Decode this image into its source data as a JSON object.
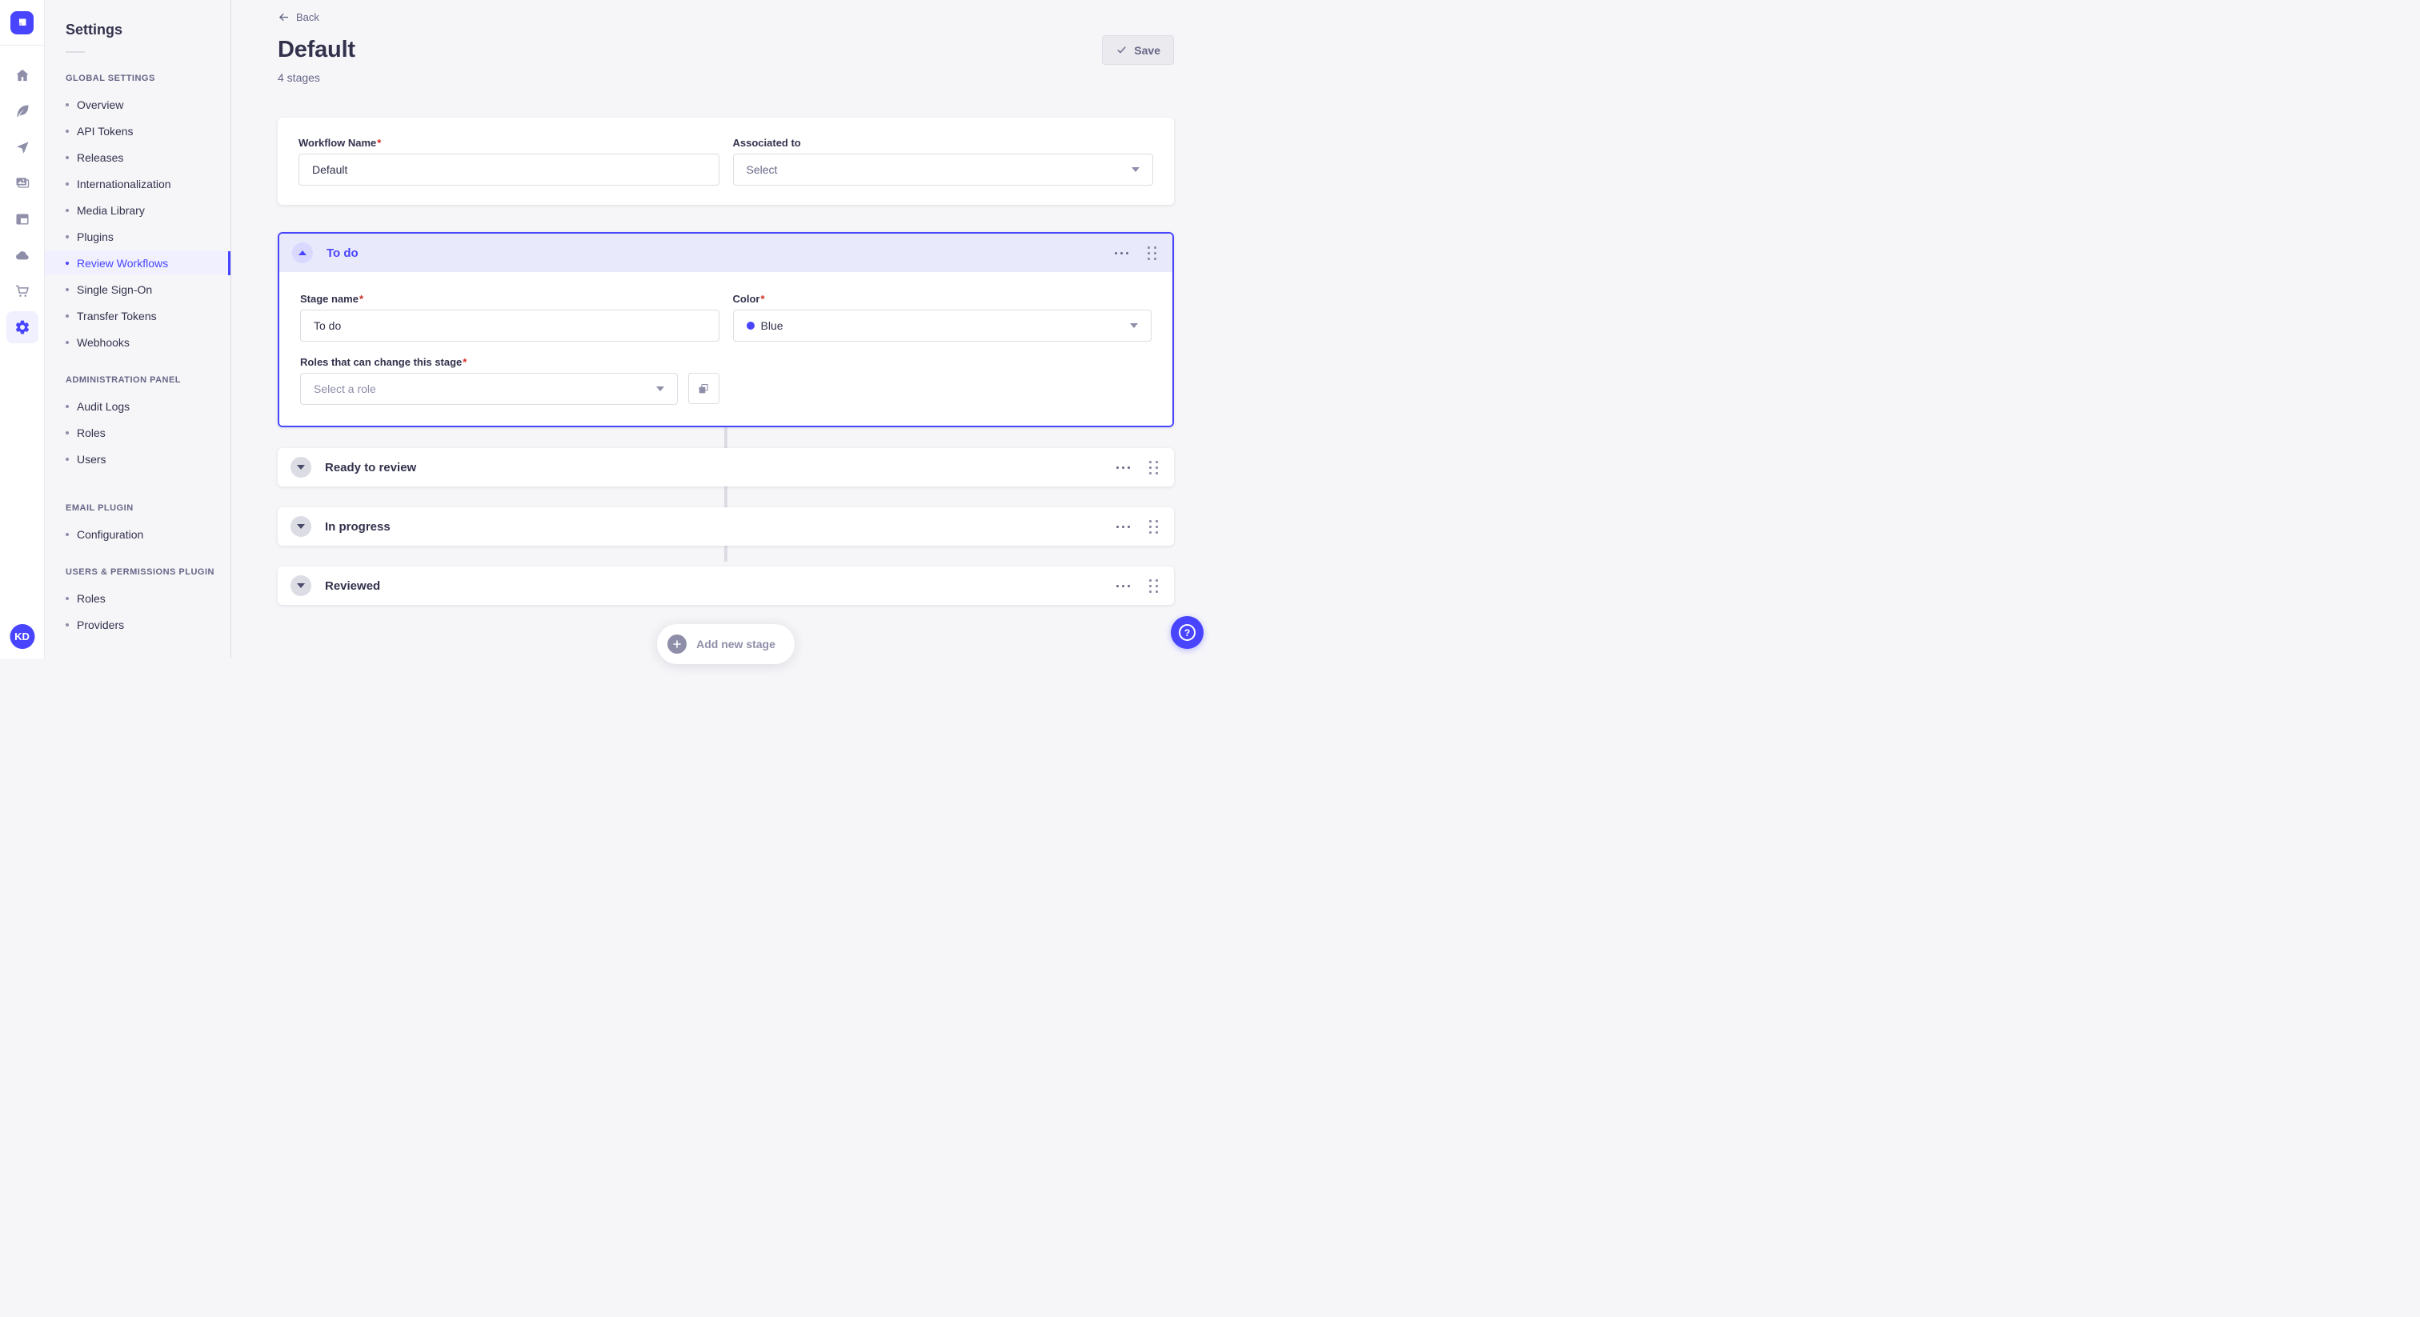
{
  "rail": {
    "avatar_initials": "KD",
    "icons": [
      "strapi-logo",
      "home",
      "feather",
      "paper-plane",
      "pictures",
      "layout",
      "cloud",
      "cart",
      "gear"
    ]
  },
  "sidebar": {
    "title": "Settings",
    "active_item": "Review Workflows",
    "sections": [
      {
        "header": "GLOBAL SETTINGS",
        "items": [
          {
            "label": "Overview"
          },
          {
            "label": "API Tokens"
          },
          {
            "label": "Releases"
          },
          {
            "label": "Internationalization"
          },
          {
            "label": "Media Library"
          },
          {
            "label": "Plugins"
          },
          {
            "label": "Review Workflows"
          },
          {
            "label": "Single Sign-On"
          },
          {
            "label": "Transfer Tokens"
          },
          {
            "label": "Webhooks"
          }
        ]
      },
      {
        "header": "ADMINISTRATION PANEL",
        "items": [
          {
            "label": "Audit Logs"
          },
          {
            "label": "Roles"
          },
          {
            "label": "Users"
          }
        ]
      },
      {
        "header": "EMAIL PLUGIN",
        "items": [
          {
            "label": "Configuration"
          }
        ]
      },
      {
        "header": "USERS & PERMISSIONS PLUGIN",
        "items": [
          {
            "label": "Roles"
          },
          {
            "label": "Providers"
          }
        ]
      }
    ]
  },
  "header": {
    "back_label": "Back",
    "title": "Default",
    "subtitle": "4 stages",
    "save_label": "Save"
  },
  "workflow_form": {
    "name_label": "Workflow Name",
    "name_value": "Default",
    "associated_label": "Associated to",
    "associated_value": "Select",
    "required_mark": "*"
  },
  "stage_expanded": {
    "title": "To do",
    "name_label": "Stage name",
    "name_value": "To do",
    "color_label": "Color",
    "color_value": "Blue",
    "color_dot_hex": "#4945ff",
    "roles_label": "Roles that can change this stage",
    "roles_placeholder": "Select a role"
  },
  "stages_collapsed": [
    {
      "title": "Ready to review"
    },
    {
      "title": "In progress"
    },
    {
      "title": "Reviewed"
    }
  ],
  "actions": {
    "add_stage_label": "Add new stage",
    "help_label": "?"
  },
  "colors": {
    "primary": "#4945ff",
    "primary_bg": "#f0f0ff",
    "accordion_header_bg": "#e9e9fc",
    "danger": "#d02b20",
    "text": "#32324d",
    "text_secondary": "#666687",
    "placeholder": "#8e8ea9",
    "border": "#dcdce4",
    "app_bg": "#f6f6f9"
  }
}
